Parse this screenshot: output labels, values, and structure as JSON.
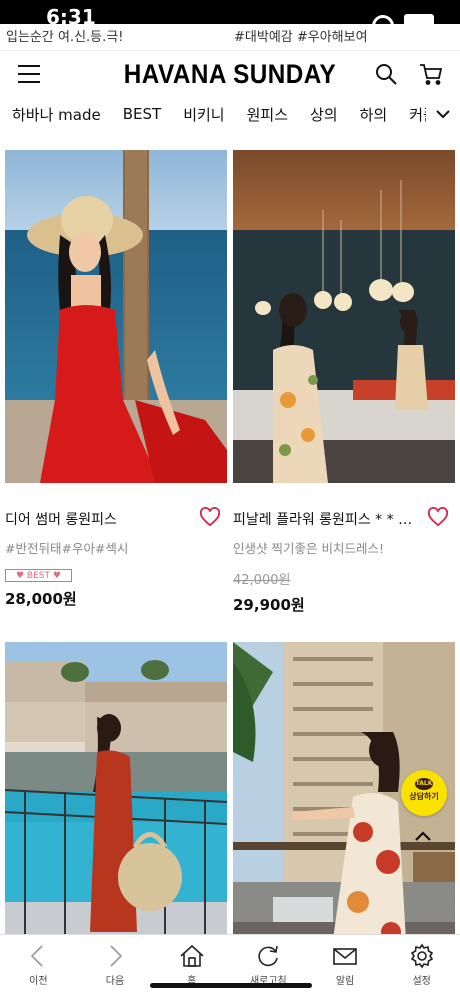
{
  "status_bar": {
    "time": "6:31"
  },
  "peek": {
    "left_text": "입는순간 여.신.등.극!",
    "right_text": "#대박예감 #우아해보여"
  },
  "header": {
    "logo": "HAVANA SUNDAY"
  },
  "categories": [
    "하바나 made",
    "BEST",
    "비키니",
    "원피스",
    "상의",
    "하의",
    "커플"
  ],
  "products": [
    {
      "name": "디어 썸머 롱원피스",
      "desc": "#반전뒤태#우아#섹시",
      "badge": "♥ BEST ♥",
      "old_price": "",
      "price": "28,000원"
    },
    {
      "name": "피날레 플라워 롱원피스 * * 주문폭주",
      "desc": "인생샷 찍기좋은 비치드레스!",
      "badge": "",
      "old_price": "42,000원",
      "price": "29,900원"
    },
    {
      "name": "",
      "desc": "",
      "badge": "",
      "old_price": "",
      "price": ""
    },
    {
      "name": "",
      "desc": "",
      "badge": "",
      "old_price": "",
      "price": ""
    }
  ],
  "talk_button": {
    "bubble": "TALK",
    "label": "상담하기"
  },
  "toolbar": {
    "items": [
      {
        "label": "이전",
        "icon": "chevron-left-icon"
      },
      {
        "label": "다음",
        "icon": "chevron-right-icon"
      },
      {
        "label": "홈",
        "icon": "home-icon"
      },
      {
        "label": "새로고침",
        "icon": "refresh-icon"
      },
      {
        "label": "알림",
        "icon": "mail-icon"
      },
      {
        "label": "설정",
        "icon": "gear-icon"
      }
    ]
  },
  "colors": {
    "accent_badge": "#e46a86",
    "heart": "#d6254a",
    "talk_yellow": "#fae100"
  }
}
